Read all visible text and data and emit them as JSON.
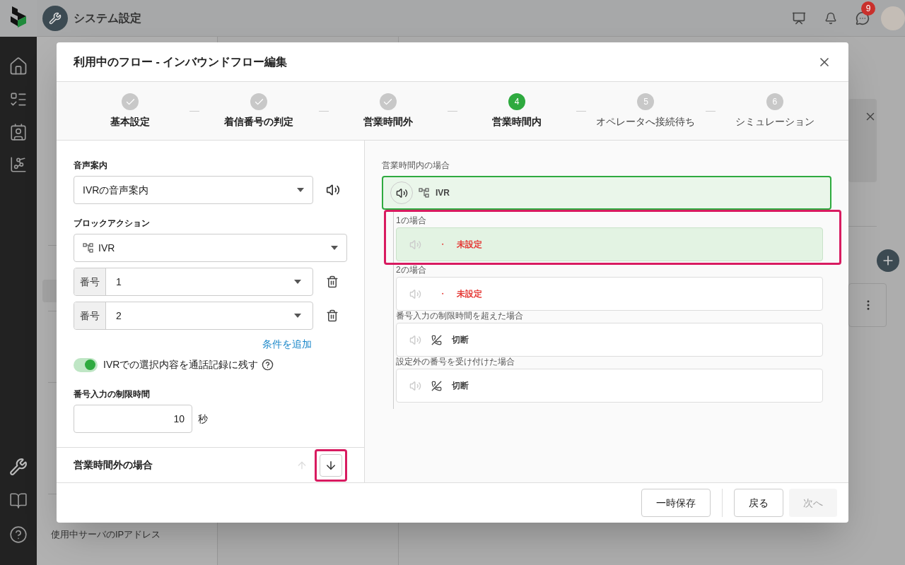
{
  "app_header": {
    "title": "システム設定",
    "notification_count": "9"
  },
  "menu": [
    {
      "label": "使用中サーバのIPアドレス"
    }
  ],
  "dialog": {
    "title": "利用中のフロー - インバウンドフロー編集",
    "steps": [
      {
        "label": "基本設定",
        "done": true,
        "selected": false
      },
      {
        "label": "着信番号の判定",
        "done": true,
        "selected": false
      },
      {
        "label": "営業時間外",
        "done": true,
        "selected": false
      },
      {
        "number": "4",
        "label": "営業時間内",
        "done": false,
        "selected": true
      },
      {
        "number": "5",
        "label": "オペレータへ接続待ち",
        "done": false,
        "selected": false
      },
      {
        "number": "6",
        "label": "シミュレーション",
        "done": false,
        "selected": false
      }
    ],
    "form": {
      "voice_label": "音声案内",
      "voice_value": "IVRの音声案内",
      "block_label": "ブロックアクション",
      "block_value": "IVR",
      "conditions": [
        {
          "prefix": "番号",
          "value": "1"
        },
        {
          "prefix": "番号",
          "value": "2"
        }
      ],
      "add_condition": "条件を追加",
      "record_toggle": {
        "label": "IVRでの選択内容を通話記録に残す",
        "on": true
      },
      "timeout_label": "番号入力の制限時間",
      "timeout_value": "10",
      "timeout_unit": "秒"
    },
    "section": {
      "title": "営業時間外の場合",
      "up_disabled": true,
      "down_highlighted": true
    },
    "flow": {
      "label": "営業時間内の場合",
      "root": "IVR",
      "branches": [
        {
          "label": "1の場合",
          "kind": "unset",
          "dot": "・",
          "action": "未設定",
          "selected": true,
          "highlighted": true
        },
        {
          "label": "2の場合",
          "kind": "unset",
          "dot": "・",
          "action": "未設定",
          "selected": false,
          "highlighted": false
        },
        {
          "label": "番号入力の制限時間を超えた場合",
          "kind": "hangup",
          "action": "切断",
          "selected": false,
          "highlighted": false
        },
        {
          "label": "設定外の番号を受け付けた場合",
          "kind": "hangup",
          "action": "切断",
          "selected": false,
          "highlighted": false
        }
      ]
    },
    "footer": [
      {
        "label": "一時保存",
        "disabled": false
      },
      {
        "label": "戻る",
        "disabled": false
      },
      {
        "label": "次へ",
        "disabled": true
      }
    ]
  }
}
